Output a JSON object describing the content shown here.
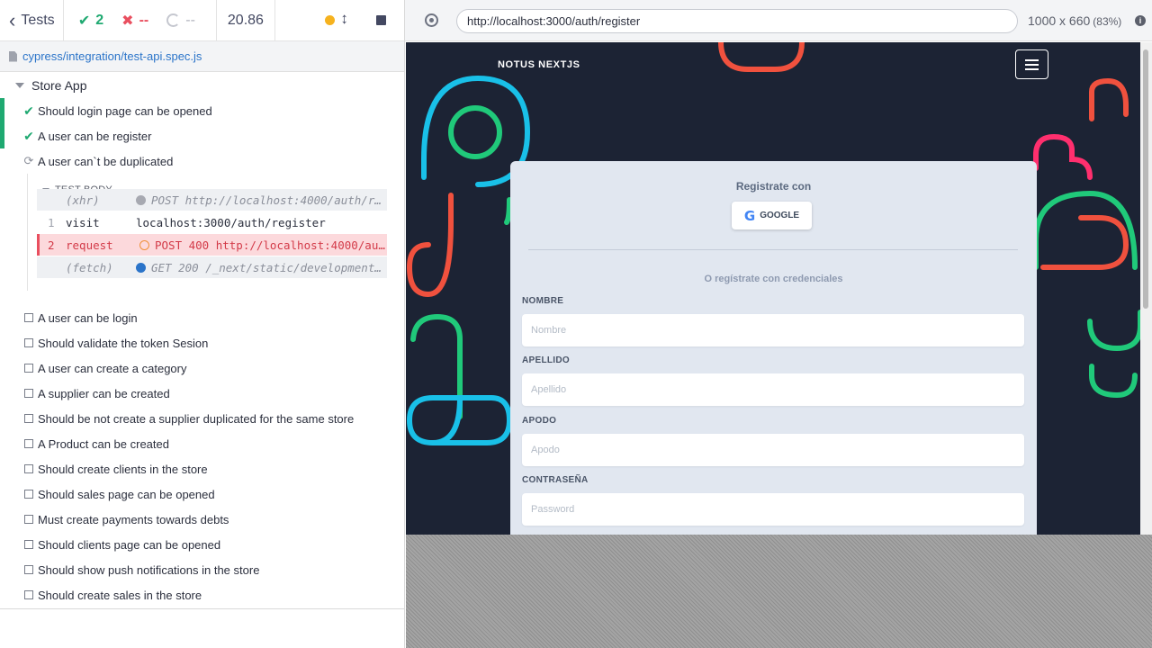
{
  "reporter": {
    "header": {
      "back_label": "Tests",
      "passed_count": "2",
      "failed_count": "--",
      "pending_count": "--",
      "duration": "20.86"
    },
    "spec_file": "cypress/integration/test-api.spec.js",
    "suite_title": "Store App",
    "tests_top": [
      {
        "label": "Should login page can be opened",
        "state": "passed"
      },
      {
        "label": "A user can be register",
        "state": "passed"
      },
      {
        "label": "A user can`t be duplicated",
        "state": "running"
      }
    ],
    "test_body": {
      "title": "TEST BODY",
      "commands": [
        {
          "num": "",
          "name": "(xhr)",
          "message": "POST http://localhost:4000/auth/r…",
          "kind": "event"
        },
        {
          "num": "1",
          "name": "visit",
          "message": "localhost:3000/auth/register",
          "kind": "normal"
        },
        {
          "num": "2",
          "name": "request",
          "message": "POST 400 http://localhost:4000/au…",
          "kind": "error"
        },
        {
          "num": "",
          "name": "(fetch)",
          "message": "GET 200 /_next/static/development…",
          "kind": "event"
        }
      ]
    },
    "tests_pending": [
      "A user can be login",
      "Should validate the token Sesion",
      "A user can create a category",
      "A supplier can be created",
      "Should be not create a supplier duplicated for the same store",
      "A Product can be created",
      "Should create clients in the store",
      "Should sales page can be opened",
      "Must create payments towards debts",
      "Should clients page can be opened",
      "Should show push notifications in the store",
      "Should create sales in the store"
    ]
  },
  "aut": {
    "url": "http://localhost:3000/auth/register",
    "viewport": "1000 x 660",
    "zoom": "(83%)",
    "info_glyph": "i"
  },
  "app": {
    "brand": "NOTUS NEXTJS",
    "card_title": "Registrate con",
    "google_label": "GOOGLE",
    "subtitle": "O regístrate con credenciales",
    "fields": [
      {
        "label": "NOMBRE",
        "placeholder": "Nombre"
      },
      {
        "label": "APELLIDO",
        "placeholder": "Apellido"
      },
      {
        "label": "APODO",
        "placeholder": "Apodo"
      },
      {
        "label": "CONTRASEÑA",
        "placeholder": "Password"
      }
    ]
  },
  "colors": {
    "pass_green": "#1fa971",
    "fail_red": "#e94f5f",
    "link_blue": "#2b74c9",
    "app_bg": "#1c2334",
    "card_bg": "#e1e7f0"
  }
}
